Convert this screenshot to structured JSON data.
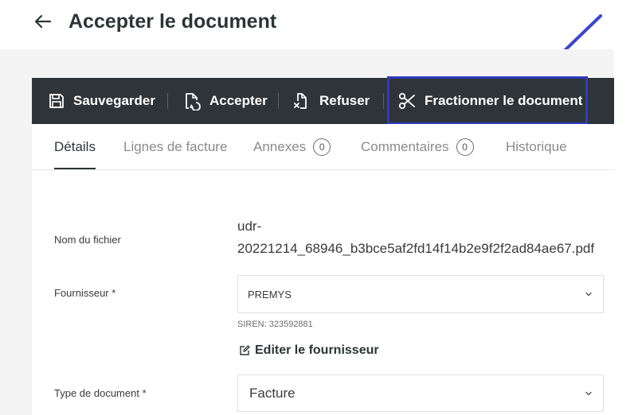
{
  "header": {
    "title": "Accepter le document"
  },
  "toolbar": {
    "save_label": "Sauvegarder",
    "accept_label": "Accepter",
    "refuse_label": "Refuser",
    "split_label": "Fractionner le document"
  },
  "tabs": [
    {
      "label": "Détails"
    },
    {
      "label": "Lignes de facture"
    },
    {
      "label": "Annexes",
      "count": "0"
    },
    {
      "label": "Commentaires",
      "count": "0"
    },
    {
      "label": "Historique"
    }
  ],
  "form": {
    "filename_label": "Nom du fichier",
    "filename_line1": "udr-",
    "filename_line2": "20221214_68946_b3bce5af2fd14f14b2e9f2f2ad84ae67.pdf",
    "supplier_label": "Fournisseur *",
    "supplier_value": "PREMYS",
    "siren": "SIREN: 323592881",
    "edit_supplier_label": "Editer le fournisseur",
    "doctype_label": "Type de document *",
    "doctype_value": "Facture"
  },
  "colors": {
    "toolbar_bg": "#2f3438",
    "highlight": "#2e3bbf",
    "band_bg": "#f4f4f4"
  },
  "icons": [
    "back-arrow-icon",
    "floppy-disk-icon",
    "doc-accept-icon",
    "doc-refuse-icon",
    "scissors-icon",
    "chevron-down-icon",
    "edit-icon"
  ]
}
